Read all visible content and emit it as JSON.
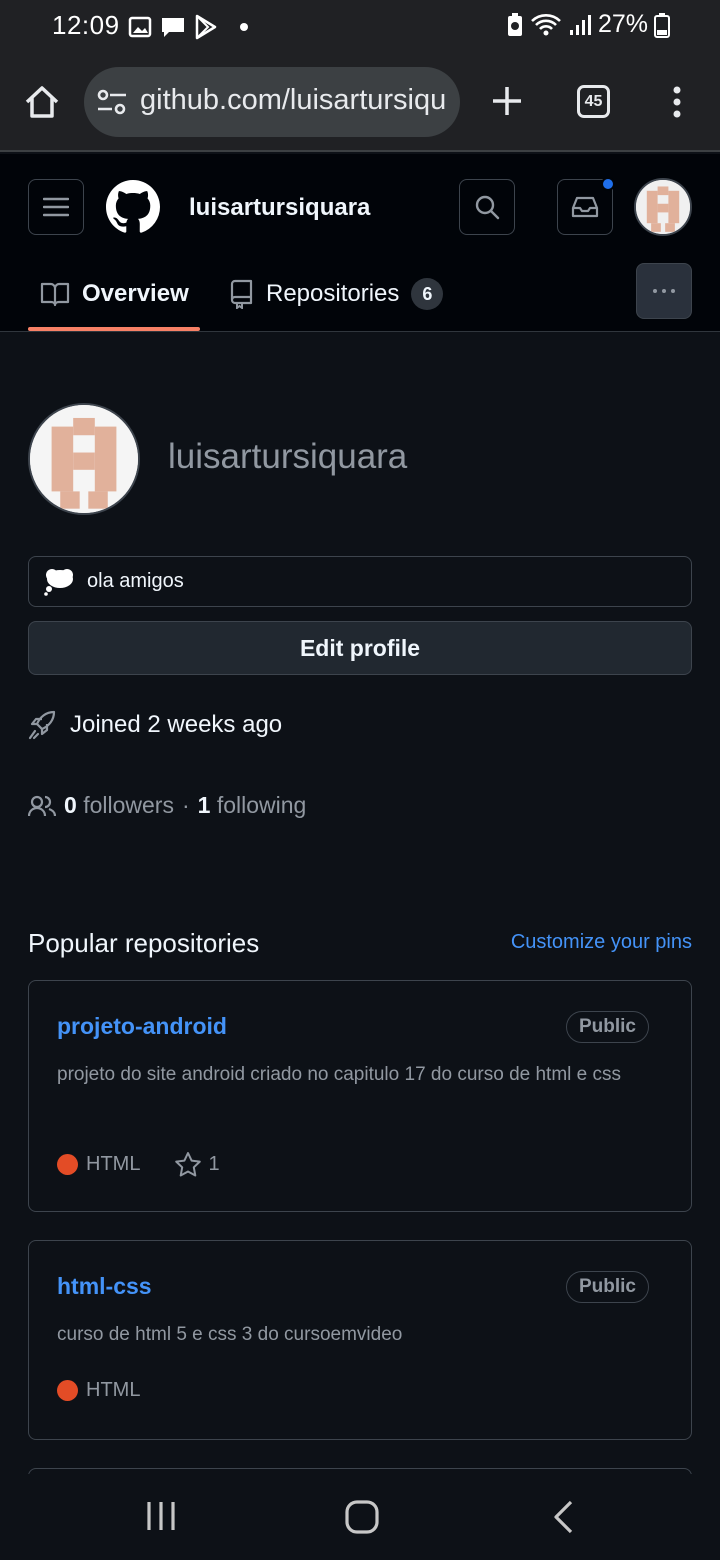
{
  "status_bar": {
    "time": "12:09",
    "battery": "27%"
  },
  "browser": {
    "url": "github.com/luisartursiquara",
    "tab_count": "45"
  },
  "header": {
    "username": "luisartursiquara",
    "tabs": [
      {
        "label": "Overview"
      },
      {
        "label": "Repositories",
        "count": "6"
      }
    ]
  },
  "profile": {
    "name": "luisartursiquara",
    "status_text": "ola amigos",
    "edit_label": "Edit profile",
    "joined": "Joined 2 weeks ago",
    "followers_count": "0",
    "followers_label": "followers",
    "separator": "·",
    "following_count": "1",
    "following_label": "following"
  },
  "popular": {
    "title": "Popular repositories",
    "customize_label": "Customize your pins",
    "repos": [
      {
        "name": "projeto-android",
        "visibility": "Public",
        "description": "projeto do site android criado no capitulo 17 do curso de html e css",
        "language": "HTML",
        "stars": "1"
      },
      {
        "name": "html-css",
        "visibility": "Public",
        "description": "curso de html 5 e css 3 do cursoemvideo",
        "language": "HTML"
      }
    ]
  },
  "colors": {
    "accent_link": "#4493f8",
    "tab_underline": "#f78166",
    "html_language": "#e34c26",
    "notification_dot": "#1f6feb"
  }
}
